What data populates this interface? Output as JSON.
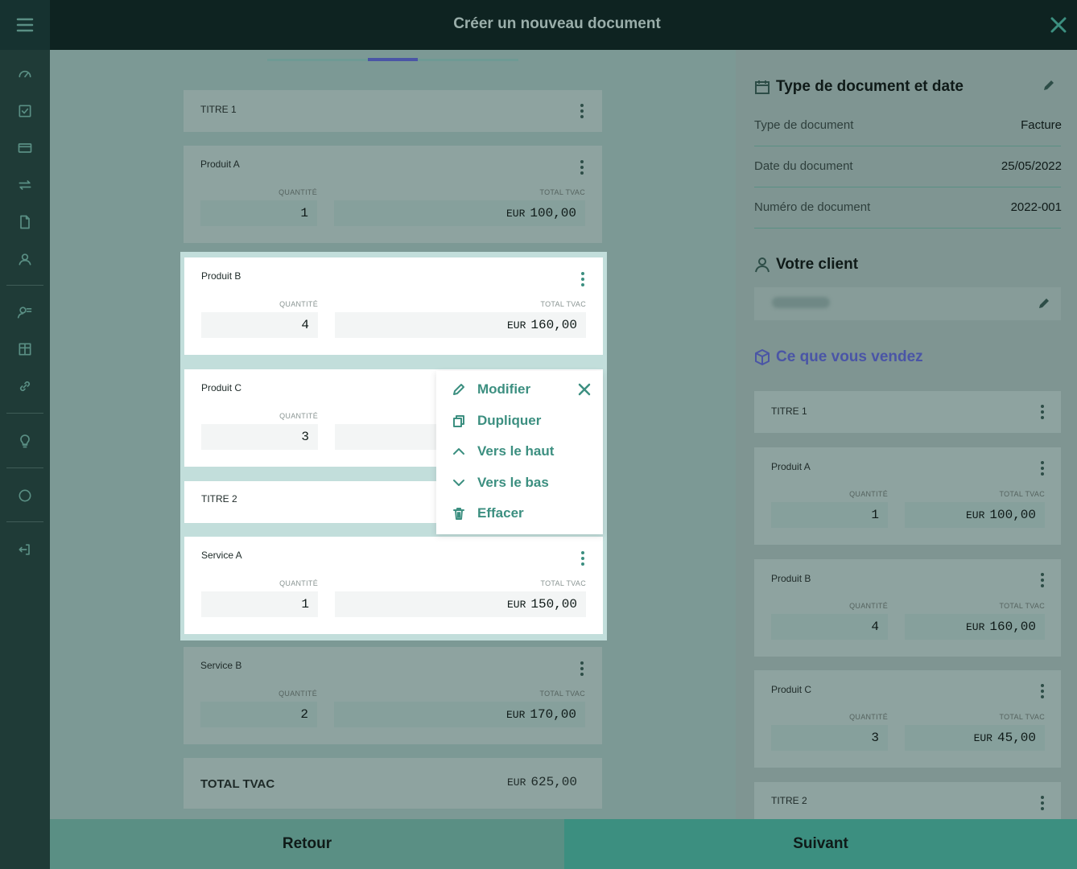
{
  "header": {
    "title": "Créer un nouveau document"
  },
  "sidebar": {
    "items": [
      {
        "icon": "dashboard-icon"
      },
      {
        "icon": "checkbox-icon"
      },
      {
        "icon": "card-icon"
      },
      {
        "icon": "transfer-icon"
      },
      {
        "icon": "document-icon"
      },
      {
        "icon": "contacts-icon"
      },
      {
        "icon": "user-list-icon"
      },
      {
        "icon": "products-icon"
      },
      {
        "icon": "link-icon"
      },
      {
        "icon": "lightbulb-icon"
      },
      {
        "icon": "circle-icon"
      },
      {
        "icon": "logout-icon"
      }
    ]
  },
  "main": {
    "titre1": "TITRE 1",
    "titre2": "TITRE 2",
    "col_qty": "QUANTITÉ",
    "col_total": "TOTAL TVAC",
    "currency": "EUR",
    "lines": [
      {
        "name": "Produit A",
        "qty": "1",
        "total": "100,00"
      },
      {
        "name": "Produit B",
        "qty": "4",
        "total": "160,00"
      },
      {
        "name": "Produit C",
        "qty": "3",
        "total": ""
      },
      {
        "name": "Service A",
        "qty": "1",
        "total": "150,00"
      },
      {
        "name": "Service B",
        "qty": "2",
        "total": "170,00"
      }
    ],
    "total_label": "TOTAL TVAC",
    "total_value": "625,00"
  },
  "menu": {
    "modifier": "Modifier",
    "dupliquer": "Dupliquer",
    "haut": "Vers le haut",
    "bas": "Vers le bas",
    "effacer": "Effacer"
  },
  "right": {
    "doc_section": "Type de document et date",
    "type_label": "Type de document",
    "type_value": "Facture",
    "date_label": "Date du document",
    "date_value": "25/05/2022",
    "num_label": "Numéro de document",
    "num_value": "2022-001",
    "client_section": "Votre client",
    "sell_section": "Ce que vous vendez",
    "accent": "#4a55a6",
    "sell_lines": [
      {
        "name": "Produit A",
        "qty": "1",
        "total": "100,00"
      },
      {
        "name": "Produit B",
        "qty": "4",
        "total": "160,00"
      },
      {
        "name": "Produit C",
        "qty": "3",
        "total": "45,00"
      }
    ]
  },
  "footer": {
    "back": "Retour",
    "next": "Suivant"
  }
}
